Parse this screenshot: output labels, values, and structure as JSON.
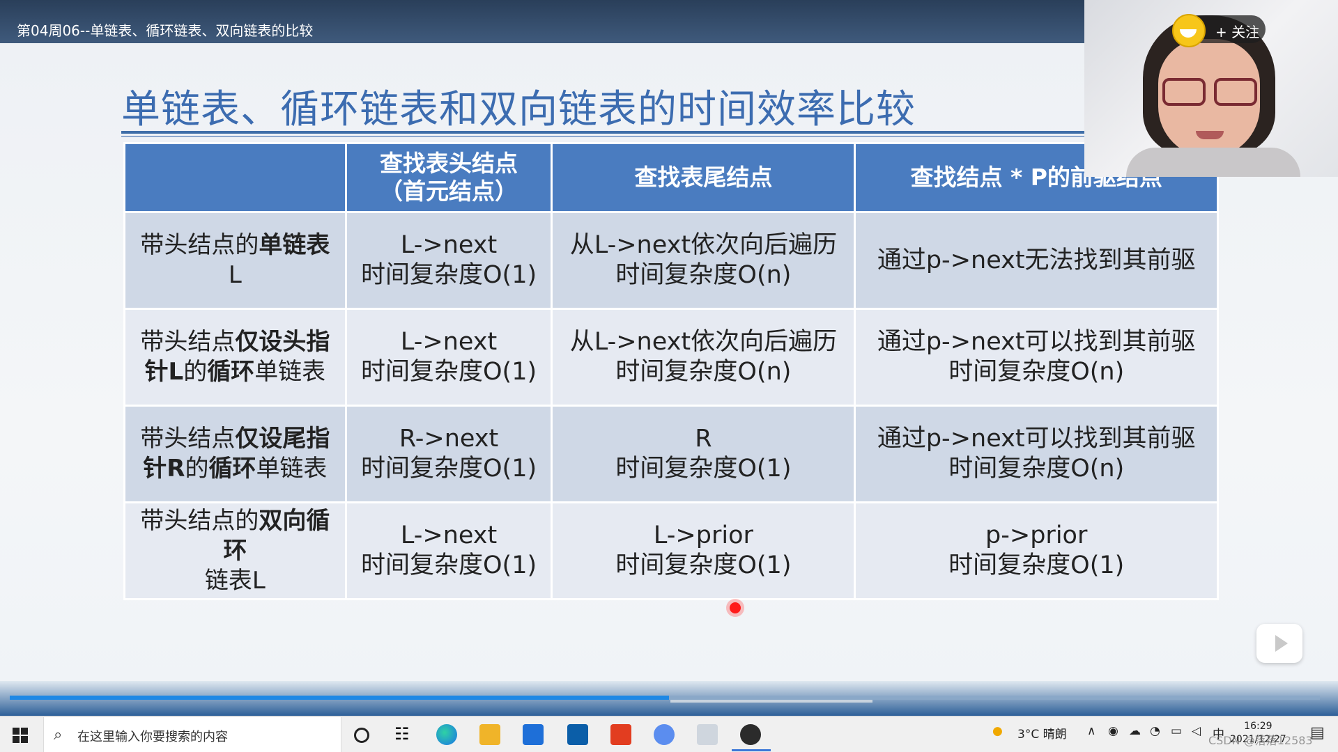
{
  "video": {
    "title": "第04周06--单链表、循环链表、双向链表的比较",
    "follow_label": "+ 关注",
    "help_icon": "?"
  },
  "slide": {
    "title": "单链表、循环链表和双向链表的时间效率比较",
    "header": {
      "c0": "",
      "c1_l1": "查找表头结点",
      "c1_l2": "（首元结点）",
      "c2": "查找表尾结点",
      "c3": "查找结点 * P的前驱结点"
    },
    "rows": [
      {
        "h_pre": "带头结点的",
        "h_bold": "单链表",
        "h_post": "L",
        "h_bold2": "",
        "h_post2": "",
        "c1_l1": "L->next",
        "c1_l2": "时间复杂度O(1)",
        "c2_l1": "从L->next依次向后遍历",
        "c2_l2": "时间复杂度O(n)",
        "c3_l1": "通过p->next无法找到其前驱",
        "c3_l2": ""
      },
      {
        "h_pre": "带头结点",
        "h_bold": "仅设头指针L",
        "h_post": "的",
        "h_bold2": "循环",
        "h_post2": "单链表",
        "c1_l1": "L->next",
        "c1_l2": "时间复杂度O(1)",
        "c2_l1": "从L->next依次向后遍历",
        "c2_l2": "时间复杂度O(n)",
        "c3_l1": "通过p->next可以找到其前驱",
        "c3_l2": "时间复杂度O(n)"
      },
      {
        "h_pre": "带头结点",
        "h_bold": "仅设尾指针R",
        "h_post": "的",
        "h_bold2": "循环",
        "h_post2": "单链表",
        "c1_l1": "R->next",
        "c1_l2": "时间复杂度O(1)",
        "c2_l1": "R",
        "c2_l2": "时间复杂度O(1)",
        "c3_l1": "通过p->next可以找到其前驱",
        "c3_l2": "时间复杂度O(n)"
      },
      {
        "h_pre": "带头结点的",
        "h_bold": "双向循环",
        "h_post": "链表L",
        "h_bold2": "",
        "h_post2": "",
        "c1_l1": "L->next",
        "c1_l2": "时间复杂度O(1)",
        "c2_l1": "L->prior",
        "c2_l2": "时间复杂度O(1)",
        "c3_l1": "p->prior",
        "c3_l2": "时间复杂度O(1)"
      }
    ]
  },
  "player": {
    "progress": 0.5
  },
  "taskbar": {
    "search_placeholder": "在这里输入你要搜索的内容",
    "weather": "3°C 晴朗",
    "ime": "中",
    "time": "16:29",
    "date": "2021/12/27",
    "watermark": "CSDN @落落12583"
  },
  "colors": {
    "title_blue": "#3c6cb0",
    "header_blue": "#4a7cc0",
    "row_dark": "#cfd8e6",
    "row_light": "#e6eaf2"
  }
}
